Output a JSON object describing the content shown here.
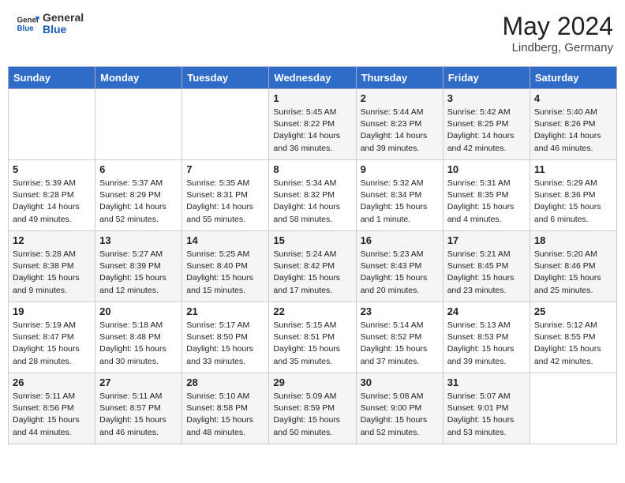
{
  "header": {
    "logo_general": "General",
    "logo_blue": "Blue",
    "title": "May 2024",
    "subtitle": "Lindberg, Germany"
  },
  "weekdays": [
    "Sunday",
    "Monday",
    "Tuesday",
    "Wednesday",
    "Thursday",
    "Friday",
    "Saturday"
  ],
  "weeks": [
    [
      {
        "day": "",
        "info": ""
      },
      {
        "day": "",
        "info": ""
      },
      {
        "day": "",
        "info": ""
      },
      {
        "day": "1",
        "info": "Sunrise: 5:45 AM\nSunset: 8:22 PM\nDaylight: 14 hours and 36 minutes."
      },
      {
        "day": "2",
        "info": "Sunrise: 5:44 AM\nSunset: 8:23 PM\nDaylight: 14 hours and 39 minutes."
      },
      {
        "day": "3",
        "info": "Sunrise: 5:42 AM\nSunset: 8:25 PM\nDaylight: 14 hours and 42 minutes."
      },
      {
        "day": "4",
        "info": "Sunrise: 5:40 AM\nSunset: 8:26 PM\nDaylight: 14 hours and 46 minutes."
      }
    ],
    [
      {
        "day": "5",
        "info": "Sunrise: 5:39 AM\nSunset: 8:28 PM\nDaylight: 14 hours and 49 minutes."
      },
      {
        "day": "6",
        "info": "Sunrise: 5:37 AM\nSunset: 8:29 PM\nDaylight: 14 hours and 52 minutes."
      },
      {
        "day": "7",
        "info": "Sunrise: 5:35 AM\nSunset: 8:31 PM\nDaylight: 14 hours and 55 minutes."
      },
      {
        "day": "8",
        "info": "Sunrise: 5:34 AM\nSunset: 8:32 PM\nDaylight: 14 hours and 58 minutes."
      },
      {
        "day": "9",
        "info": "Sunrise: 5:32 AM\nSunset: 8:34 PM\nDaylight: 15 hours and 1 minute."
      },
      {
        "day": "10",
        "info": "Sunrise: 5:31 AM\nSunset: 8:35 PM\nDaylight: 15 hours and 4 minutes."
      },
      {
        "day": "11",
        "info": "Sunrise: 5:29 AM\nSunset: 8:36 PM\nDaylight: 15 hours and 6 minutes."
      }
    ],
    [
      {
        "day": "12",
        "info": "Sunrise: 5:28 AM\nSunset: 8:38 PM\nDaylight: 15 hours and 9 minutes."
      },
      {
        "day": "13",
        "info": "Sunrise: 5:27 AM\nSunset: 8:39 PM\nDaylight: 15 hours and 12 minutes."
      },
      {
        "day": "14",
        "info": "Sunrise: 5:25 AM\nSunset: 8:40 PM\nDaylight: 15 hours and 15 minutes."
      },
      {
        "day": "15",
        "info": "Sunrise: 5:24 AM\nSunset: 8:42 PM\nDaylight: 15 hours and 17 minutes."
      },
      {
        "day": "16",
        "info": "Sunrise: 5:23 AM\nSunset: 8:43 PM\nDaylight: 15 hours and 20 minutes."
      },
      {
        "day": "17",
        "info": "Sunrise: 5:21 AM\nSunset: 8:45 PM\nDaylight: 15 hours and 23 minutes."
      },
      {
        "day": "18",
        "info": "Sunrise: 5:20 AM\nSunset: 8:46 PM\nDaylight: 15 hours and 25 minutes."
      }
    ],
    [
      {
        "day": "19",
        "info": "Sunrise: 5:19 AM\nSunset: 8:47 PM\nDaylight: 15 hours and 28 minutes."
      },
      {
        "day": "20",
        "info": "Sunrise: 5:18 AM\nSunset: 8:48 PM\nDaylight: 15 hours and 30 minutes."
      },
      {
        "day": "21",
        "info": "Sunrise: 5:17 AM\nSunset: 8:50 PM\nDaylight: 15 hours and 33 minutes."
      },
      {
        "day": "22",
        "info": "Sunrise: 5:15 AM\nSunset: 8:51 PM\nDaylight: 15 hours and 35 minutes."
      },
      {
        "day": "23",
        "info": "Sunrise: 5:14 AM\nSunset: 8:52 PM\nDaylight: 15 hours and 37 minutes."
      },
      {
        "day": "24",
        "info": "Sunrise: 5:13 AM\nSunset: 8:53 PM\nDaylight: 15 hours and 39 minutes."
      },
      {
        "day": "25",
        "info": "Sunrise: 5:12 AM\nSunset: 8:55 PM\nDaylight: 15 hours and 42 minutes."
      }
    ],
    [
      {
        "day": "26",
        "info": "Sunrise: 5:11 AM\nSunset: 8:56 PM\nDaylight: 15 hours and 44 minutes."
      },
      {
        "day": "27",
        "info": "Sunrise: 5:11 AM\nSunset: 8:57 PM\nDaylight: 15 hours and 46 minutes."
      },
      {
        "day": "28",
        "info": "Sunrise: 5:10 AM\nSunset: 8:58 PM\nDaylight: 15 hours and 48 minutes."
      },
      {
        "day": "29",
        "info": "Sunrise: 5:09 AM\nSunset: 8:59 PM\nDaylight: 15 hours and 50 minutes."
      },
      {
        "day": "30",
        "info": "Sunrise: 5:08 AM\nSunset: 9:00 PM\nDaylight: 15 hours and 52 minutes."
      },
      {
        "day": "31",
        "info": "Sunrise: 5:07 AM\nSunset: 9:01 PM\nDaylight: 15 hours and 53 minutes."
      },
      {
        "day": "",
        "info": ""
      }
    ]
  ]
}
